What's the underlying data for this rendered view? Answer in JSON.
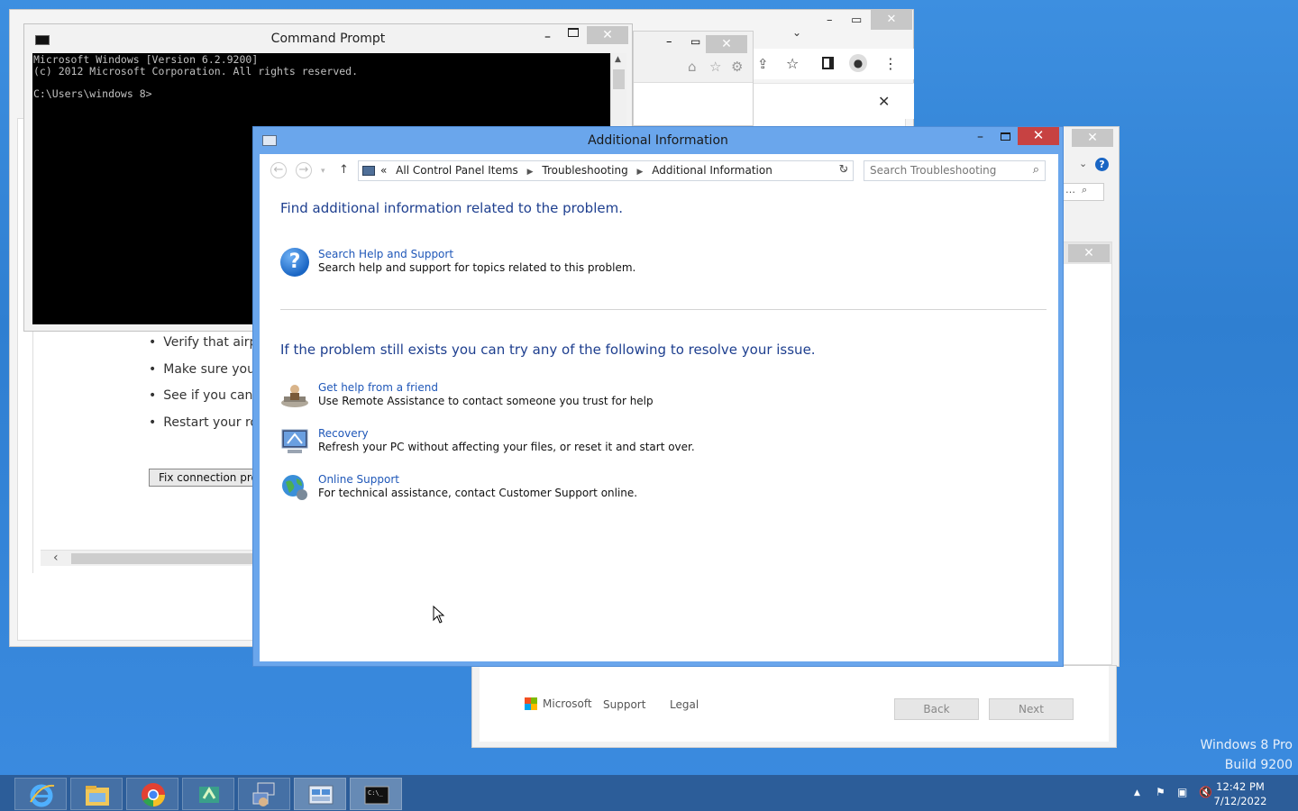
{
  "desktop": {
    "watermark_line1": "Windows 8 Pro",
    "watermark_line2": "Build 9200"
  },
  "cmd_window": {
    "title": "Command Prompt",
    "console_lines": [
      "Microsoft Windows [Version 6.2.9200]",
      "(c) 2012 Microsoft Corporation. All rights reserved.",
      "",
      "C:\\Users\\windows 8>"
    ],
    "minimize": "–",
    "close": "✕"
  },
  "network_troubleshooter": {
    "bullets": [
      "Verify that airpl",
      "Make sure your",
      "See if you can c",
      "Restart your ro"
    ],
    "fix_button": "Fix connection prob"
  },
  "dialog": {
    "title": "Additional Information",
    "close": "✕",
    "minimize": "–",
    "address_parts": [
      "«",
      "All Control Panel Items",
      "Troubleshooting",
      "Additional Information"
    ],
    "search_placeholder": "Search Troubleshooting",
    "heading1": "Find additional information related to the problem.",
    "help_item": {
      "link": "Search Help and Support",
      "desc": "Search help and support for topics related to this problem."
    },
    "heading2": "If the problem still exists you can try any of the following to resolve your issue.",
    "options": [
      {
        "link": "Get help from a friend",
        "desc": "Use Remote Assistance to contact someone you trust for help",
        "icon": "remote-assistance-icon"
      },
      {
        "link": "Recovery",
        "desc": "Refresh your PC without affecting your files, or reset it and start over.",
        "icon": "recovery-icon"
      },
      {
        "link": "Online Support",
        "desc": "For technical assistance, contact Customer Support online.",
        "icon": "globe-icon"
      }
    ]
  },
  "footer_window": {
    "brand": "Microsoft",
    "support": "Support",
    "legal": "Legal",
    "back": "Back",
    "next": "Next"
  },
  "taskbar": {
    "apps": [
      "internet-explorer",
      "file-explorer",
      "chrome",
      "onenote",
      "remote-desktop",
      "control-panel",
      "command-prompt"
    ],
    "time": "12:42 PM",
    "date": "7/12/2022"
  }
}
